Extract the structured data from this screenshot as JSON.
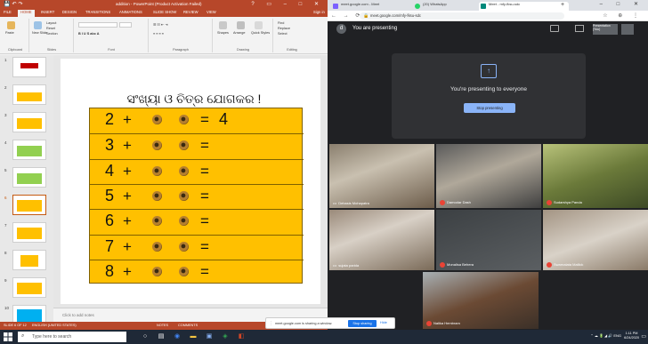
{
  "ppt": {
    "title": "addition - PowerPoint (Product Activation Failed)",
    "signin": "Sign in",
    "tabs": [
      "FILE",
      "HOME",
      "INSERT",
      "DESIGN",
      "TRANSITIONS",
      "ANIMATIONS",
      "SLIDE SHOW",
      "REVIEW",
      "VIEW"
    ],
    "ribbon_groups": [
      "Clipboard",
      "Slides",
      "Font",
      "Paragraph",
      "Drawing",
      "Editing"
    ],
    "ribbon_items": {
      "paste": "Paste",
      "new_slide": "New Slide",
      "layout": "Layout",
      "reset": "Reset",
      "section": "Section",
      "shape": "Shapes",
      "arrange": "Arrange",
      "quick_styles": "Quick Styles",
      "find": "Find",
      "replace": "Replace",
      "select": "Select"
    },
    "slide_numbers": [
      "1",
      "2",
      "3",
      "4",
      "5",
      "6",
      "7",
      "8",
      "9",
      "10"
    ],
    "slide": {
      "title": "ସଂଖ୍ୟା ଓ ଚିତ୍ର ଯୋଗକର !",
      "rows": [
        {
          "num": "2",
          "plus": "+",
          "eq": "=",
          "ans": "4"
        },
        {
          "num": "3",
          "plus": "+",
          "eq": "=",
          "ans": ""
        },
        {
          "num": "4",
          "plus": "+",
          "eq": "=",
          "ans": ""
        },
        {
          "num": "5",
          "plus": "+",
          "eq": "=",
          "ans": ""
        },
        {
          "num": "6",
          "plus": "+",
          "eq": "=",
          "ans": ""
        },
        {
          "num": "7",
          "plus": "+",
          "eq": "=",
          "ans": ""
        },
        {
          "num": "8",
          "plus": "+",
          "eq": "=",
          "ans": ""
        }
      ]
    },
    "notes_placeholder": "Click to add notes",
    "status": {
      "slide": "SLIDE 6 OF 12",
      "lang": "ENGLISH (UNITED STATES)",
      "notes": "NOTES",
      "comments": "COMMENTS"
    }
  },
  "browser": {
    "tabs": [
      "meet.google.com - Meet",
      "(20) WhatsApp",
      "Meet - mfy-fksu-sdc"
    ],
    "url": "meet.google.com/mfy-fksu-sdc",
    "presenting_label": "You are presenting",
    "avatar_letter": "d",
    "presentation_owner": "Presentation (You)",
    "present_card": {
      "text": "You're presenting to everyone",
      "button": "Stop presenting"
    },
    "participants": [
      "Debasis Mohapatra",
      "Damodar Dash",
      "Sudarshya Panda",
      "sujata parida",
      "Monalisa Behera",
      "Swarnalata Mallick",
      "Nalika Hembram"
    ]
  },
  "share_banner": {
    "text": "meet.google.com is sharing a window.",
    "stop": "Stop sharing",
    "hide": "Hide"
  },
  "taskbar": {
    "search": "Type here to search",
    "time": "1:11 PM",
    "date": "6/24/2020",
    "lang": "ENG"
  }
}
